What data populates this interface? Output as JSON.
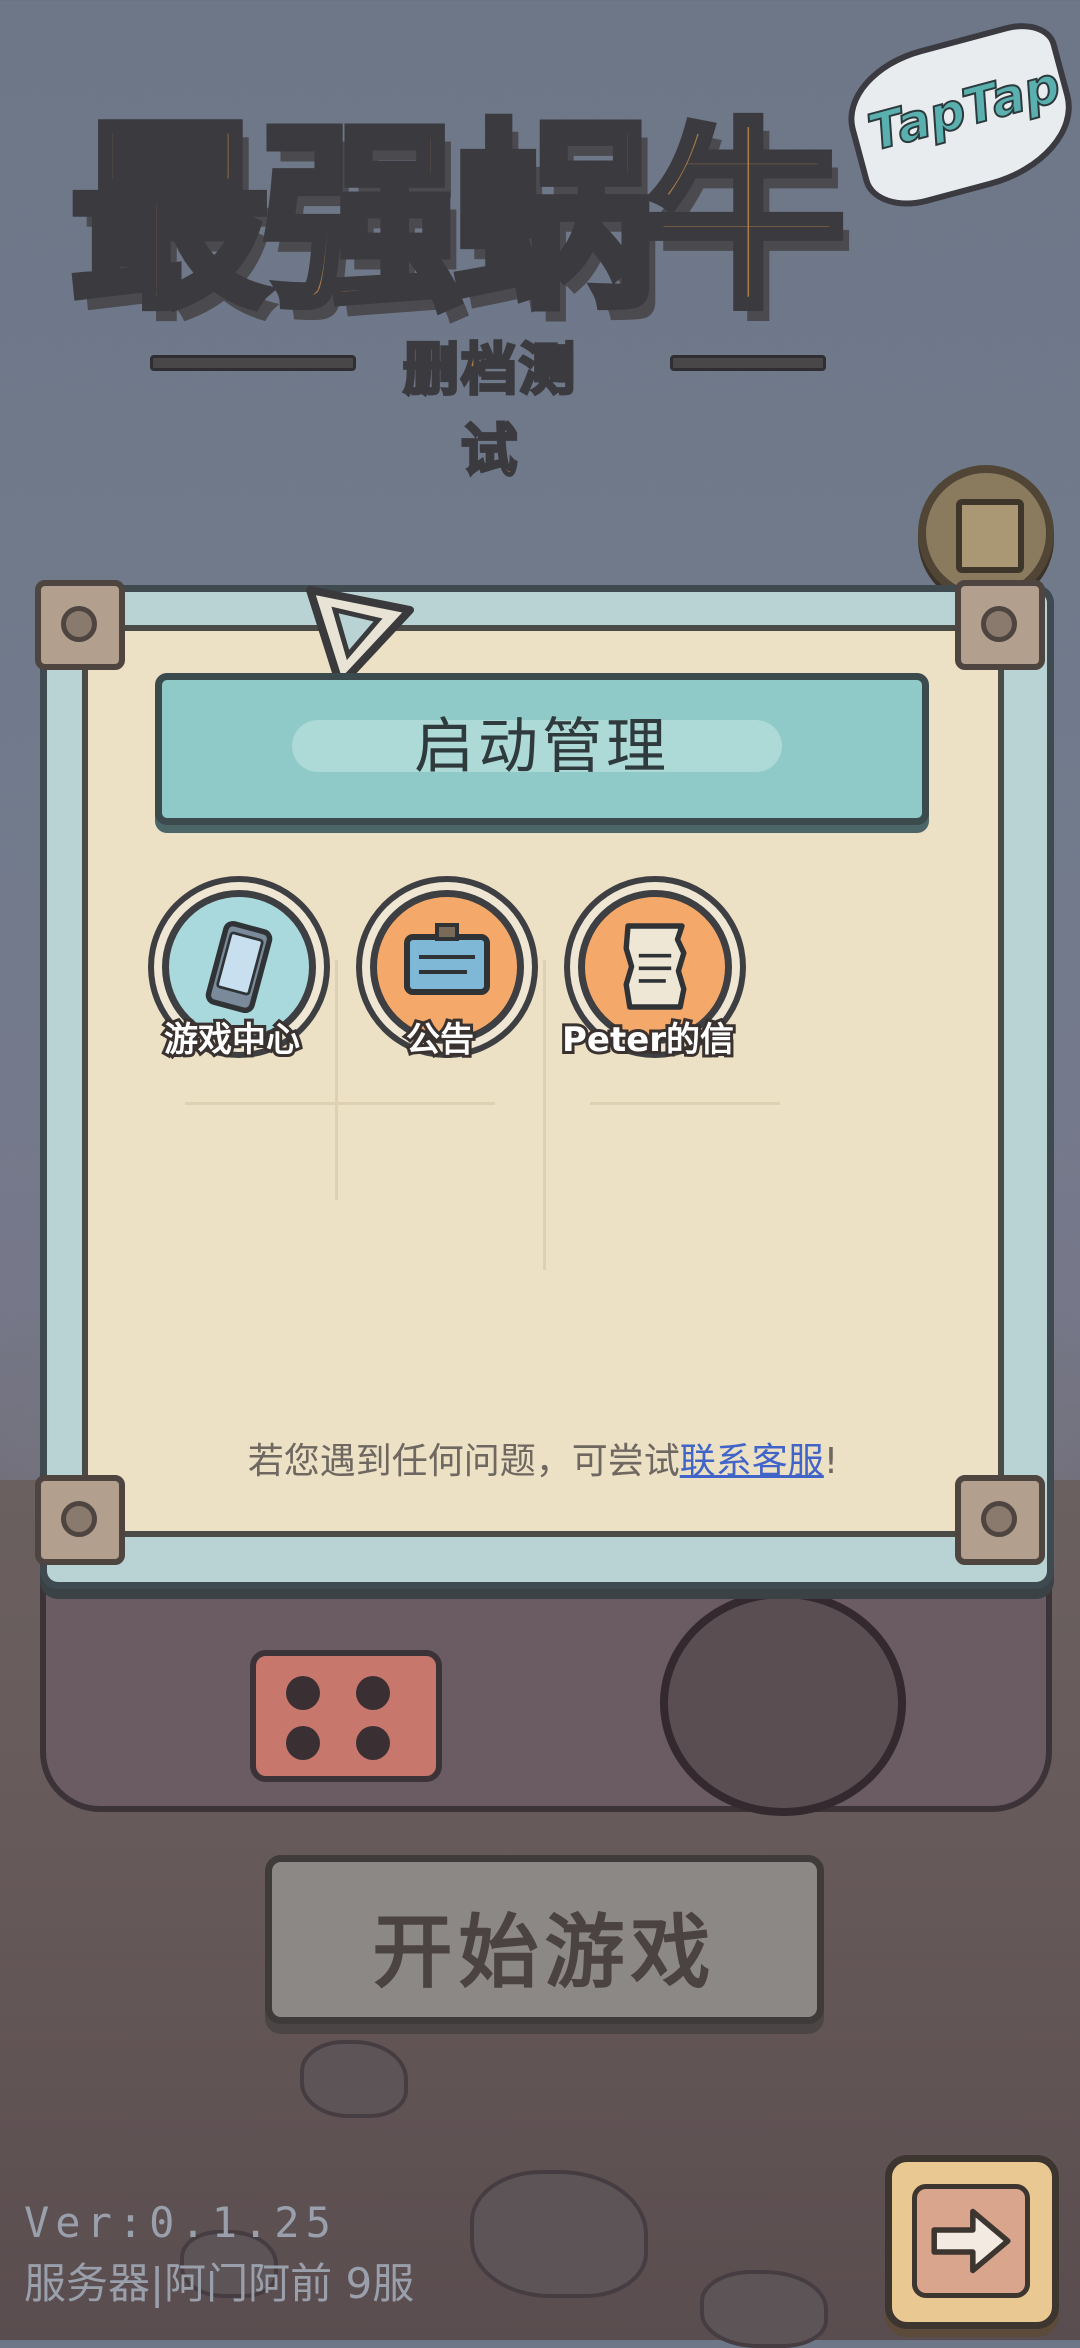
{
  "logo": {
    "title": "最强蜗牛",
    "subtitle": "删档测试",
    "badge": "TapTap"
  },
  "panel": {
    "header_title": "启动管理",
    "items": [
      {
        "label": "游戏中心",
        "icon": "phone-icon",
        "color": "#a9d9dd"
      },
      {
        "label": "公告",
        "icon": "notice-board-icon",
        "color": "#f4a86a"
      },
      {
        "label": "Peter的信",
        "icon": "letter-icon",
        "color": "#f4a86a"
      }
    ],
    "help_text": "若您遇到任何问题，可尝试",
    "help_link": "联系客服",
    "help_suffix": "!"
  },
  "start_button": {
    "label": "开始游戏"
  },
  "footer": {
    "version": "Ver:0.1.25",
    "server": "服务器|阿门阿前  9服"
  },
  "colors": {
    "panel_bg": "#ece0c5",
    "header_bar": "#8fcac9",
    "link": "#4064c8"
  }
}
